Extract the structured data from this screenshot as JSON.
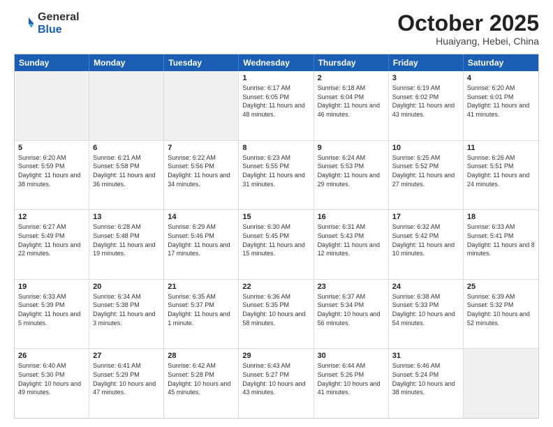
{
  "logo": {
    "general": "General",
    "blue": "Blue"
  },
  "header": {
    "month": "October 2025",
    "location": "Huaiyang, Hebei, China"
  },
  "days": [
    "Sunday",
    "Monday",
    "Tuesday",
    "Wednesday",
    "Thursday",
    "Friday",
    "Saturday"
  ],
  "weeks": [
    [
      {
        "day": "",
        "content": ""
      },
      {
        "day": "",
        "content": ""
      },
      {
        "day": "",
        "content": ""
      },
      {
        "day": "1",
        "content": "Sunrise: 6:17 AM\nSunset: 6:05 PM\nDaylight: 11 hours and 48 minutes."
      },
      {
        "day": "2",
        "content": "Sunrise: 6:18 AM\nSunset: 6:04 PM\nDaylight: 11 hours and 46 minutes."
      },
      {
        "day": "3",
        "content": "Sunrise: 6:19 AM\nSunset: 6:02 PM\nDaylight: 11 hours and 43 minutes."
      },
      {
        "day": "4",
        "content": "Sunrise: 6:20 AM\nSunset: 6:01 PM\nDaylight: 11 hours and 41 minutes."
      }
    ],
    [
      {
        "day": "5",
        "content": "Sunrise: 6:20 AM\nSunset: 5:59 PM\nDaylight: 11 hours and 38 minutes."
      },
      {
        "day": "6",
        "content": "Sunrise: 6:21 AM\nSunset: 5:58 PM\nDaylight: 11 hours and 36 minutes."
      },
      {
        "day": "7",
        "content": "Sunrise: 6:22 AM\nSunset: 5:56 PM\nDaylight: 11 hours and 34 minutes."
      },
      {
        "day": "8",
        "content": "Sunrise: 6:23 AM\nSunset: 5:55 PM\nDaylight: 11 hours and 31 minutes."
      },
      {
        "day": "9",
        "content": "Sunrise: 6:24 AM\nSunset: 5:53 PM\nDaylight: 11 hours and 29 minutes."
      },
      {
        "day": "10",
        "content": "Sunrise: 6:25 AM\nSunset: 5:52 PM\nDaylight: 11 hours and 27 minutes."
      },
      {
        "day": "11",
        "content": "Sunrise: 6:26 AM\nSunset: 5:51 PM\nDaylight: 11 hours and 24 minutes."
      }
    ],
    [
      {
        "day": "12",
        "content": "Sunrise: 6:27 AM\nSunset: 5:49 PM\nDaylight: 11 hours and 22 minutes."
      },
      {
        "day": "13",
        "content": "Sunrise: 6:28 AM\nSunset: 5:48 PM\nDaylight: 11 hours and 19 minutes."
      },
      {
        "day": "14",
        "content": "Sunrise: 6:29 AM\nSunset: 5:46 PM\nDaylight: 11 hours and 17 minutes."
      },
      {
        "day": "15",
        "content": "Sunrise: 6:30 AM\nSunset: 5:45 PM\nDaylight: 11 hours and 15 minutes."
      },
      {
        "day": "16",
        "content": "Sunrise: 6:31 AM\nSunset: 5:43 PM\nDaylight: 11 hours and 12 minutes."
      },
      {
        "day": "17",
        "content": "Sunrise: 6:32 AM\nSunset: 5:42 PM\nDaylight: 11 hours and 10 minutes."
      },
      {
        "day": "18",
        "content": "Sunrise: 6:33 AM\nSunset: 5:41 PM\nDaylight: 11 hours and 8 minutes."
      }
    ],
    [
      {
        "day": "19",
        "content": "Sunrise: 6:33 AM\nSunset: 5:39 PM\nDaylight: 11 hours and 5 minutes."
      },
      {
        "day": "20",
        "content": "Sunrise: 6:34 AM\nSunset: 5:38 PM\nDaylight: 11 hours and 3 minutes."
      },
      {
        "day": "21",
        "content": "Sunrise: 6:35 AM\nSunset: 5:37 PM\nDaylight: 11 hours and 1 minute."
      },
      {
        "day": "22",
        "content": "Sunrise: 6:36 AM\nSunset: 5:35 PM\nDaylight: 10 hours and 58 minutes."
      },
      {
        "day": "23",
        "content": "Sunrise: 6:37 AM\nSunset: 5:34 PM\nDaylight: 10 hours and 56 minutes."
      },
      {
        "day": "24",
        "content": "Sunrise: 6:38 AM\nSunset: 5:33 PM\nDaylight: 10 hours and 54 minutes."
      },
      {
        "day": "25",
        "content": "Sunrise: 6:39 AM\nSunset: 5:32 PM\nDaylight: 10 hours and 52 minutes."
      }
    ],
    [
      {
        "day": "26",
        "content": "Sunrise: 6:40 AM\nSunset: 5:30 PM\nDaylight: 10 hours and 49 minutes."
      },
      {
        "day": "27",
        "content": "Sunrise: 6:41 AM\nSunset: 5:29 PM\nDaylight: 10 hours and 47 minutes."
      },
      {
        "day": "28",
        "content": "Sunrise: 6:42 AM\nSunset: 5:28 PM\nDaylight: 10 hours and 45 minutes."
      },
      {
        "day": "29",
        "content": "Sunrise: 6:43 AM\nSunset: 5:27 PM\nDaylight: 10 hours and 43 minutes."
      },
      {
        "day": "30",
        "content": "Sunrise: 6:44 AM\nSunset: 5:26 PM\nDaylight: 10 hours and 41 minutes."
      },
      {
        "day": "31",
        "content": "Sunrise: 6:46 AM\nSunset: 5:24 PM\nDaylight: 10 hours and 38 minutes."
      },
      {
        "day": "",
        "content": ""
      }
    ]
  ]
}
